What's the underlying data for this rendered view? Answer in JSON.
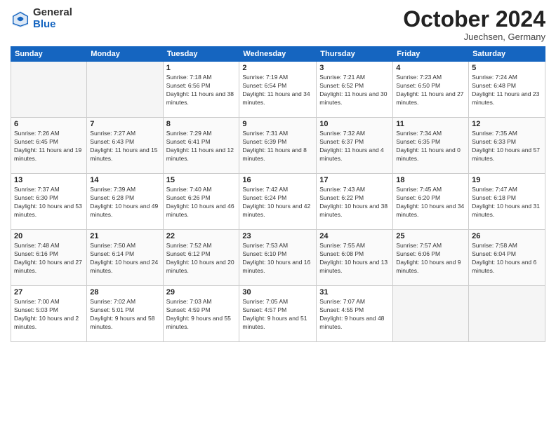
{
  "header": {
    "logo_general": "General",
    "logo_blue": "Blue",
    "month_title": "October 2024",
    "location": "Juechsen, Germany"
  },
  "weekdays": [
    "Sunday",
    "Monday",
    "Tuesday",
    "Wednesday",
    "Thursday",
    "Friday",
    "Saturday"
  ],
  "weeks": [
    [
      {
        "day": "",
        "empty": true
      },
      {
        "day": "",
        "empty": true
      },
      {
        "day": "1",
        "sunrise": "Sunrise: 7:18 AM",
        "sunset": "Sunset: 6:56 PM",
        "daylight": "Daylight: 11 hours and 38 minutes."
      },
      {
        "day": "2",
        "sunrise": "Sunrise: 7:19 AM",
        "sunset": "Sunset: 6:54 PM",
        "daylight": "Daylight: 11 hours and 34 minutes."
      },
      {
        "day": "3",
        "sunrise": "Sunrise: 7:21 AM",
        "sunset": "Sunset: 6:52 PM",
        "daylight": "Daylight: 11 hours and 30 minutes."
      },
      {
        "day": "4",
        "sunrise": "Sunrise: 7:23 AM",
        "sunset": "Sunset: 6:50 PM",
        "daylight": "Daylight: 11 hours and 27 minutes."
      },
      {
        "day": "5",
        "sunrise": "Sunrise: 7:24 AM",
        "sunset": "Sunset: 6:48 PM",
        "daylight": "Daylight: 11 hours and 23 minutes."
      }
    ],
    [
      {
        "day": "6",
        "sunrise": "Sunrise: 7:26 AM",
        "sunset": "Sunset: 6:45 PM",
        "daylight": "Daylight: 11 hours and 19 minutes."
      },
      {
        "day": "7",
        "sunrise": "Sunrise: 7:27 AM",
        "sunset": "Sunset: 6:43 PM",
        "daylight": "Daylight: 11 hours and 15 minutes."
      },
      {
        "day": "8",
        "sunrise": "Sunrise: 7:29 AM",
        "sunset": "Sunset: 6:41 PM",
        "daylight": "Daylight: 11 hours and 12 minutes."
      },
      {
        "day": "9",
        "sunrise": "Sunrise: 7:31 AM",
        "sunset": "Sunset: 6:39 PM",
        "daylight": "Daylight: 11 hours and 8 minutes."
      },
      {
        "day": "10",
        "sunrise": "Sunrise: 7:32 AM",
        "sunset": "Sunset: 6:37 PM",
        "daylight": "Daylight: 11 hours and 4 minutes."
      },
      {
        "day": "11",
        "sunrise": "Sunrise: 7:34 AM",
        "sunset": "Sunset: 6:35 PM",
        "daylight": "Daylight: 11 hours and 0 minutes."
      },
      {
        "day": "12",
        "sunrise": "Sunrise: 7:35 AM",
        "sunset": "Sunset: 6:33 PM",
        "daylight": "Daylight: 10 hours and 57 minutes."
      }
    ],
    [
      {
        "day": "13",
        "sunrise": "Sunrise: 7:37 AM",
        "sunset": "Sunset: 6:30 PM",
        "daylight": "Daylight: 10 hours and 53 minutes."
      },
      {
        "day": "14",
        "sunrise": "Sunrise: 7:39 AM",
        "sunset": "Sunset: 6:28 PM",
        "daylight": "Daylight: 10 hours and 49 minutes."
      },
      {
        "day": "15",
        "sunrise": "Sunrise: 7:40 AM",
        "sunset": "Sunset: 6:26 PM",
        "daylight": "Daylight: 10 hours and 46 minutes."
      },
      {
        "day": "16",
        "sunrise": "Sunrise: 7:42 AM",
        "sunset": "Sunset: 6:24 PM",
        "daylight": "Daylight: 10 hours and 42 minutes."
      },
      {
        "day": "17",
        "sunrise": "Sunrise: 7:43 AM",
        "sunset": "Sunset: 6:22 PM",
        "daylight": "Daylight: 10 hours and 38 minutes."
      },
      {
        "day": "18",
        "sunrise": "Sunrise: 7:45 AM",
        "sunset": "Sunset: 6:20 PM",
        "daylight": "Daylight: 10 hours and 34 minutes."
      },
      {
        "day": "19",
        "sunrise": "Sunrise: 7:47 AM",
        "sunset": "Sunset: 6:18 PM",
        "daylight": "Daylight: 10 hours and 31 minutes."
      }
    ],
    [
      {
        "day": "20",
        "sunrise": "Sunrise: 7:48 AM",
        "sunset": "Sunset: 6:16 PM",
        "daylight": "Daylight: 10 hours and 27 minutes."
      },
      {
        "day": "21",
        "sunrise": "Sunrise: 7:50 AM",
        "sunset": "Sunset: 6:14 PM",
        "daylight": "Daylight: 10 hours and 24 minutes."
      },
      {
        "day": "22",
        "sunrise": "Sunrise: 7:52 AM",
        "sunset": "Sunset: 6:12 PM",
        "daylight": "Daylight: 10 hours and 20 minutes."
      },
      {
        "day": "23",
        "sunrise": "Sunrise: 7:53 AM",
        "sunset": "Sunset: 6:10 PM",
        "daylight": "Daylight: 10 hours and 16 minutes."
      },
      {
        "day": "24",
        "sunrise": "Sunrise: 7:55 AM",
        "sunset": "Sunset: 6:08 PM",
        "daylight": "Daylight: 10 hours and 13 minutes."
      },
      {
        "day": "25",
        "sunrise": "Sunrise: 7:57 AM",
        "sunset": "Sunset: 6:06 PM",
        "daylight": "Daylight: 10 hours and 9 minutes."
      },
      {
        "day": "26",
        "sunrise": "Sunrise: 7:58 AM",
        "sunset": "Sunset: 6:04 PM",
        "daylight": "Daylight: 10 hours and 6 minutes."
      }
    ],
    [
      {
        "day": "27",
        "sunrise": "Sunrise: 7:00 AM",
        "sunset": "Sunset: 5:03 PM",
        "daylight": "Daylight: 10 hours and 2 minutes."
      },
      {
        "day": "28",
        "sunrise": "Sunrise: 7:02 AM",
        "sunset": "Sunset: 5:01 PM",
        "daylight": "Daylight: 9 hours and 58 minutes."
      },
      {
        "day": "29",
        "sunrise": "Sunrise: 7:03 AM",
        "sunset": "Sunset: 4:59 PM",
        "daylight": "Daylight: 9 hours and 55 minutes."
      },
      {
        "day": "30",
        "sunrise": "Sunrise: 7:05 AM",
        "sunset": "Sunset: 4:57 PM",
        "daylight": "Daylight: 9 hours and 51 minutes."
      },
      {
        "day": "31",
        "sunrise": "Sunrise: 7:07 AM",
        "sunset": "Sunset: 4:55 PM",
        "daylight": "Daylight: 9 hours and 48 minutes."
      },
      {
        "day": "",
        "empty": true
      },
      {
        "day": "",
        "empty": true
      }
    ]
  ]
}
